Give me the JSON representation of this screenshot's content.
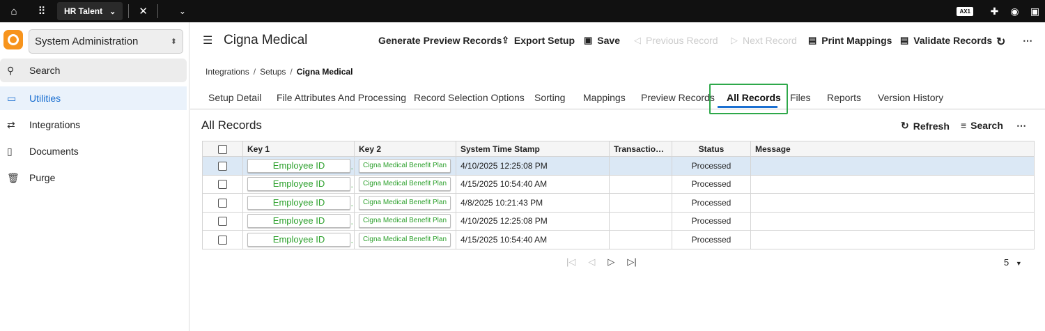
{
  "topbar": {
    "app_tab": "HR Talent",
    "badge": "AX1",
    "icons": [
      "home-icon",
      "grid-icon",
      "chevron-down-icon",
      "close-icon",
      "chevron-down-icon",
      "medical-cross-icon",
      "user-circle-icon",
      "panel-icon"
    ]
  },
  "sidebar": {
    "selector": "System Administration",
    "items": [
      {
        "label": "Search",
        "icon": "search-icon"
      },
      {
        "label": "Utilities",
        "icon": "briefcase-icon"
      },
      {
        "label": "Integrations",
        "icon": "arrows-icon"
      },
      {
        "label": "Documents",
        "icon": "document-icon"
      },
      {
        "label": "Purge",
        "icon": "trash-icon"
      }
    ]
  },
  "header": {
    "title": "Cigna Medical",
    "buttons": {
      "generate": "Generate Preview Records",
      "export": "Export Setup",
      "save": "Save",
      "previous": "Previous Record",
      "next": "Next Record",
      "print": "Print Mappings",
      "validate": "Validate Records"
    }
  },
  "breadcrumb": [
    "Integrations",
    "Setups",
    "Cigna Medical"
  ],
  "tabs": [
    "Setup Detail",
    "File Attributes And Processing",
    "Record Selection Options",
    "Sorting",
    "Mappings",
    "Preview Records",
    "All Records",
    "Files",
    "Reports",
    "Version History"
  ],
  "active_tab": "All Records",
  "section": {
    "title": "All Records",
    "refresh": "Refresh",
    "search": "Search"
  },
  "table": {
    "columns": [
      "Key 1",
      "Key 2",
      "System Time Stamp",
      "Transaction...",
      "Status",
      "Message"
    ],
    "rows": [
      {
        "key1": "Employee ID",
        "key2": "Cigna Medical Benefit Plan",
        "timestamp": "4/10/2025 12:25:08 PM",
        "transaction": "",
        "status": "Processed",
        "message": ""
      },
      {
        "key1": "Employee ID",
        "key2": "Cigna Medical Benefit Plan",
        "timestamp": "4/15/2025 10:54:40 AM",
        "transaction": "",
        "status": "Processed",
        "message": ""
      },
      {
        "key1": "Employee ID",
        "key2": "Cigna Medical Benefit Plan",
        "timestamp": "4/8/2025 10:21:43 PM",
        "transaction": "",
        "status": "Processed",
        "message": ""
      },
      {
        "key1": "Employee ID",
        "key2": "Cigna Medical Benefit Plan",
        "timestamp": "4/10/2025 12:25:08 PM",
        "transaction": "",
        "status": "Processed",
        "message": ""
      },
      {
        "key1": "Employee ID",
        "key2": "Cigna Medical Benefit Plan",
        "timestamp": "4/15/2025 10:54:40 AM",
        "transaction": "",
        "status": "Processed",
        "message": ""
      }
    ]
  },
  "pager": {
    "page_size": "5"
  }
}
